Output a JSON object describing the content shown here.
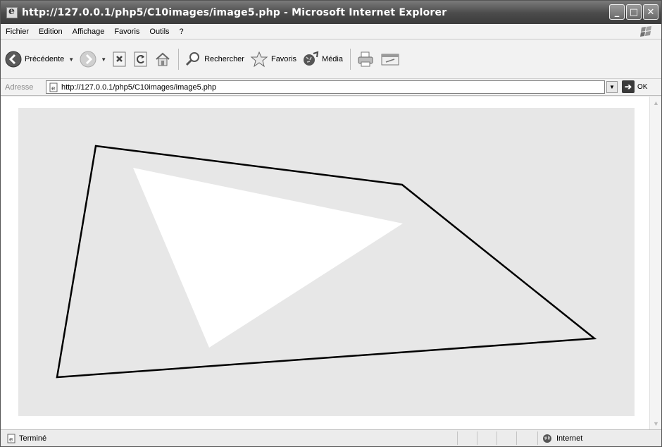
{
  "window": {
    "title": "http://127.0.0.1/php5/C10images/image5.php - Microsoft Internet Explorer",
    "controls": {
      "minimize": "_",
      "maximize": "□",
      "close": "✕"
    }
  },
  "menu": {
    "items": [
      "Fichier",
      "Edition",
      "Affichage",
      "Favoris",
      "Outils",
      "?"
    ]
  },
  "toolbar": {
    "back_label": "Précédente",
    "search_label": "Rechercher",
    "favorites_label": "Favoris",
    "media_label": "Média"
  },
  "address": {
    "label": "Adresse",
    "url": "http://127.0.0.1/php5/C10images/image5.php",
    "go_label": "OK"
  },
  "status": {
    "text": "Terminé",
    "zone": "Internet"
  },
  "image": {
    "background_color": "#e7e7e7",
    "outline_color": "#000000",
    "fill_color": "#ffffff"
  }
}
